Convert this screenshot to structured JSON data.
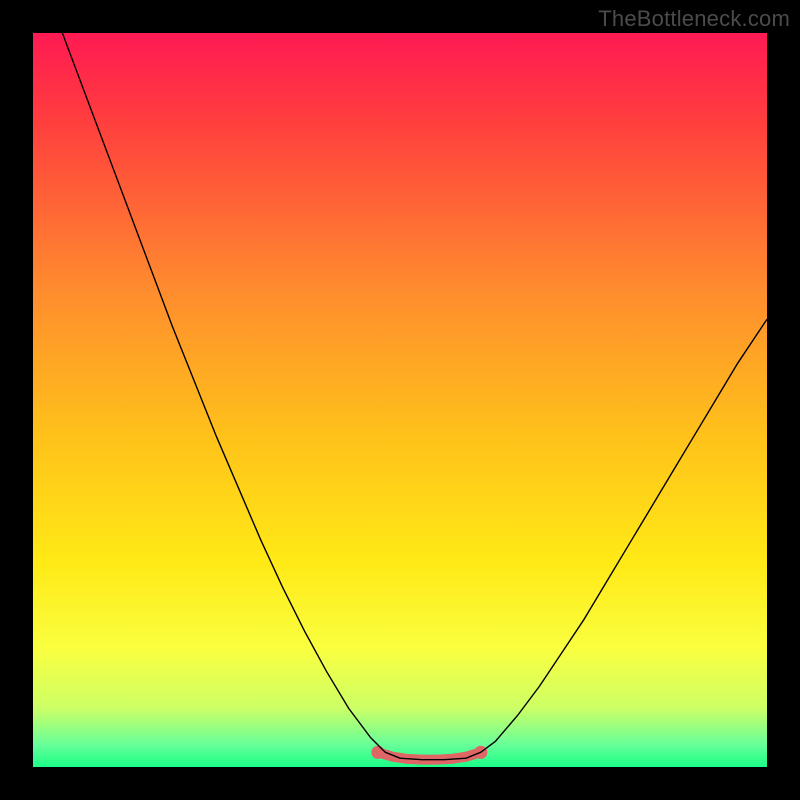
{
  "watermark": "TheBottleneck.com",
  "chart_data": {
    "type": "line",
    "title": "",
    "xlabel": "",
    "ylabel": "",
    "xlim": [
      0,
      100
    ],
    "ylim": [
      0,
      100
    ],
    "background": {
      "kind": "vertical-gradient",
      "stops": [
        {
          "offset": 0.0,
          "color": "#ff1a53"
        },
        {
          "offset": 0.12,
          "color": "#ff3e3e"
        },
        {
          "offset": 0.35,
          "color": "#ff8c2e"
        },
        {
          "offset": 0.55,
          "color": "#ffc21a"
        },
        {
          "offset": 0.72,
          "color": "#ffe916"
        },
        {
          "offset": 0.84,
          "color": "#f9ff40"
        },
        {
          "offset": 0.92,
          "color": "#ccff66"
        },
        {
          "offset": 0.97,
          "color": "#66ff99"
        },
        {
          "offset": 1.0,
          "color": "#1aff88"
        }
      ]
    },
    "series": [
      {
        "name": "curve",
        "color": "#000000",
        "width": 1.4,
        "points": [
          {
            "x": 4.0,
            "y": 100.0
          },
          {
            "x": 7.0,
            "y": 92.0
          },
          {
            "x": 10.0,
            "y": 84.0
          },
          {
            "x": 13.0,
            "y": 76.0
          },
          {
            "x": 16.0,
            "y": 68.0
          },
          {
            "x": 19.0,
            "y": 60.0
          },
          {
            "x": 22.0,
            "y": 52.5
          },
          {
            "x": 25.0,
            "y": 45.0
          },
          {
            "x": 28.0,
            "y": 38.0
          },
          {
            "x": 31.0,
            "y": 31.0
          },
          {
            "x": 34.0,
            "y": 24.5
          },
          {
            "x": 37.0,
            "y": 18.5
          },
          {
            "x": 40.0,
            "y": 13.0
          },
          {
            "x": 43.0,
            "y": 8.0
          },
          {
            "x": 46.0,
            "y": 4.0
          },
          {
            "x": 48.0,
            "y": 2.0
          },
          {
            "x": 50.0,
            "y": 1.2
          },
          {
            "x": 53.0,
            "y": 1.0
          },
          {
            "x": 56.0,
            "y": 1.0
          },
          {
            "x": 59.0,
            "y": 1.2
          },
          {
            "x": 61.0,
            "y": 2.0
          },
          {
            "x": 63.0,
            "y": 3.5
          },
          {
            "x": 66.0,
            "y": 7.0
          },
          {
            "x": 69.0,
            "y": 11.0
          },
          {
            "x": 72.0,
            "y": 15.5
          },
          {
            "x": 75.0,
            "y": 20.0
          },
          {
            "x": 78.0,
            "y": 25.0
          },
          {
            "x": 81.0,
            "y": 30.0
          },
          {
            "x": 84.0,
            "y": 35.0
          },
          {
            "x": 87.0,
            "y": 40.0
          },
          {
            "x": 90.0,
            "y": 45.0
          },
          {
            "x": 93.0,
            "y": 50.0
          },
          {
            "x": 96.0,
            "y": 55.0
          },
          {
            "x": 100.0,
            "y": 61.0
          }
        ]
      },
      {
        "name": "emphasis-bottom-segment",
        "color": "#e06666",
        "width": 10,
        "linecap": "round",
        "points": [
          {
            "x": 47.0,
            "y": 2.0
          },
          {
            "x": 49.0,
            "y": 1.4
          },
          {
            "x": 51.0,
            "y": 1.1
          },
          {
            "x": 53.0,
            "y": 1.0
          },
          {
            "x": 55.0,
            "y": 1.0
          },
          {
            "x": 57.0,
            "y": 1.1
          },
          {
            "x": 59.0,
            "y": 1.4
          },
          {
            "x": 61.0,
            "y": 2.0
          }
        ],
        "endpoints": [
          {
            "x": 47.0,
            "y": 2.0
          },
          {
            "x": 61.0,
            "y": 2.0
          }
        ]
      }
    ]
  }
}
